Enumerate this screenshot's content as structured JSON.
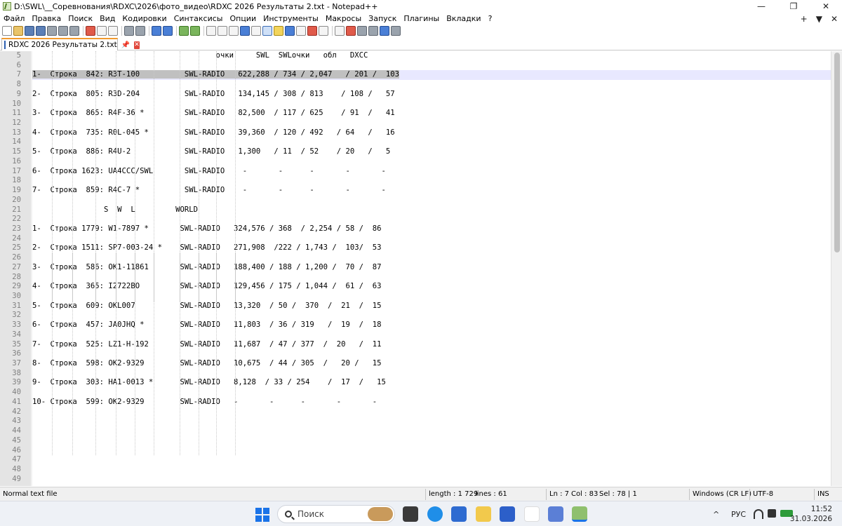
{
  "window": {
    "title": "D:\\SWL\\__Соревнования\\RDXC\\2026\\фото_видео\\RDXC 2026 Результаты 2.txt - Notepad++",
    "minimize_glyph": "—",
    "restore_glyph": "❐",
    "close_glyph": "✕"
  },
  "menu": {
    "items": [
      "Файл",
      "Правка",
      "Поиск",
      "Вид",
      "Кодировки",
      "Синтаксисы",
      "Опции",
      "Инструменты",
      "Макросы",
      "Запуск",
      "Плагины",
      "Вкладки",
      "?"
    ],
    "right_plus": "+",
    "right_dropdown": "▼",
    "right_close": "✕"
  },
  "tab": {
    "label": "RDXC 2026 Результаты 2.txt",
    "pin_glyph": "📌",
    "close_glyph": "✕"
  },
  "editor": {
    "current_line": 7,
    "lines": [
      {
        "n": 5,
        "text": "                                         очки     SWL  SWLочки   обл   DXCC"
      },
      {
        "n": 6,
        "text": ""
      },
      {
        "n": 7,
        "text": "1-  Строка  842: R3T-100          SWL-RADIO   622,288 / 734 / 2,047   / 201 /  103"
      },
      {
        "n": 8,
        "text": ""
      },
      {
        "n": 9,
        "text": "2-  Строка  805: R3D-204          SWL-RADIO   134,145 / 308 / 813    / 108 /   57"
      },
      {
        "n": 10,
        "text": ""
      },
      {
        "n": 11,
        "text": "3-  Строка  865: R4F-36 *         SWL-RADIO   82,500  / 117 / 625    / 91  /   41"
      },
      {
        "n": 12,
        "text": ""
      },
      {
        "n": 13,
        "text": "4-  Строка  735: R0L-045 *        SWL-RADIO   39,360  / 120 / 492   / 64   /   16"
      },
      {
        "n": 14,
        "text": ""
      },
      {
        "n": 15,
        "text": "5-  Строка  886: R4U-2            SWL-RADIO   1,300   / 11  / 52    / 20   /   5"
      },
      {
        "n": 16,
        "text": ""
      },
      {
        "n": 17,
        "text": "6-  Строка 1623: UA4CCC/SWL       SWL-RADIO    -       -      -       -       -"
      },
      {
        "n": 18,
        "text": ""
      },
      {
        "n": 19,
        "text": "7-  Строка  859: R4C-7 *          SWL-RADIO    -       -      -       -       -"
      },
      {
        "n": 20,
        "text": ""
      },
      {
        "n": 21,
        "text": "                S  W  L         WORLD"
      },
      {
        "n": 22,
        "text": ""
      },
      {
        "n": 23,
        "text": "1-  Строка 1779: W1-7897 *       SWL-RADIO   324,576 / 368  / 2,254 / 58 /  86"
      },
      {
        "n": 24,
        "text": ""
      },
      {
        "n": 25,
        "text": "2-  Строка 1511: SP7-003-24 *    SWL-RADIO   271,908  /222 / 1,743 /  103/  53"
      },
      {
        "n": 26,
        "text": ""
      },
      {
        "n": 27,
        "text": "3-  Строка  586: OK1-11861       SWL-RADIO   188,400 / 188 / 1,200 /  70 /  87"
      },
      {
        "n": 28,
        "text": ""
      },
      {
        "n": 29,
        "text": "4-  Строка  365: I2722BO         SWL-RADIO   129,456 / 175 / 1,044 /  61 /  63"
      },
      {
        "n": 30,
        "text": ""
      },
      {
        "n": 31,
        "text": "5-  Строка  609: OKL007          SWL-RADIO   13,320  / 50 /  370  /  21  /  15"
      },
      {
        "n": 32,
        "text": ""
      },
      {
        "n": 33,
        "text": "6-  Строка  457: JA0JHQ *        SWL-RADIO   11,803  / 36 / 319   /  19  /  18"
      },
      {
        "n": 34,
        "text": ""
      },
      {
        "n": 35,
        "text": "7-  Строка  525: LZ1-H-192       SWL-RADIO   11,687  / 47 / 377  /  20   /  11"
      },
      {
        "n": 36,
        "text": ""
      },
      {
        "n": 37,
        "text": "8-  Строка  598: OK2-9329        SWL-RADIO   10,675  / 44 / 305  /   20 /   15"
      },
      {
        "n": 38,
        "text": ""
      },
      {
        "n": 39,
        "text": "9-  Строка  303: HA1-0013 *      SWL-RADIO   8,128  / 33 / 254    /  17  /   15"
      },
      {
        "n": 40,
        "text": ""
      },
      {
        "n": 41,
        "text": "10- Строка  599: OK2-9329        SWL-RADIO   -       -      -       -       -"
      },
      {
        "n": 42,
        "text": ""
      },
      {
        "n": 43,
        "text": ""
      },
      {
        "n": 44,
        "text": ""
      },
      {
        "n": 45,
        "text": ""
      },
      {
        "n": 46,
        "text": ""
      },
      {
        "n": 47,
        "text": ""
      },
      {
        "n": 48,
        "text": ""
      },
      {
        "n": 49,
        "text": ""
      }
    ]
  },
  "status": {
    "file_type": "Normal text file",
    "length": "length : 1 729",
    "lines": "lines : 61",
    "ln": "Ln : 7",
    "col": "Col : 83",
    "sel": "Sel : 78 | 1",
    "eol": "Windows (CR LF)",
    "encoding": "UTF-8",
    "mode": "INS"
  },
  "taskbar": {
    "search_placeholder": "Поиск",
    "language": "РУС",
    "time": "11:52",
    "date": "31.03.2026",
    "tray_chevron": "^"
  },
  "colors": {
    "tab_accent": "#f29a2e",
    "current_line_bg": "#e8e8ff",
    "selection_bg": "#c0c0c0",
    "gutter_bg": "#e4e4e4",
    "line_number": "#808080",
    "windows_accent": "#1a73e8"
  }
}
